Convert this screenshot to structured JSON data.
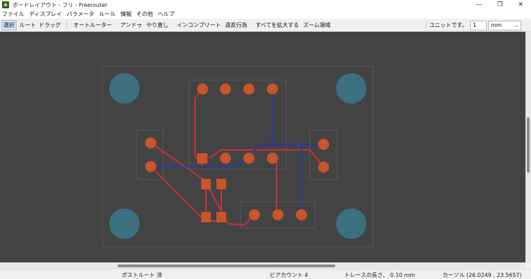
{
  "window": {
    "title": "ボードレイアウト - フリ - Freerouter",
    "controls": [
      "—",
      "❐",
      "✕"
    ]
  },
  "menu": [
    "ファイル",
    "ディスプレイ",
    "パラメータ",
    "ルール",
    "情報",
    "その他",
    "ヘルプ"
  ],
  "toolbar": {
    "select": "選択",
    "route": "ルート",
    "drag": "ドラッグ",
    "autorouter": "オートルーター",
    "undo": "アンドゥ",
    "redo": "やり直し",
    "incomplete": "インコンプリート",
    "violations": "違反行為",
    "zoom_all": "すべてを拡大する",
    "zoom_region": "ズーム領域",
    "unit_label": "ユニットです。",
    "unit_value": "1",
    "unit_select": "mm"
  },
  "status": {
    "postroute": "ポストルート 済",
    "via_count": "ビアカウント 4",
    "trace_length": "トレースの長さ、 0.10 mm",
    "cursor": "カーソル (26.0249 , 23.5657)"
  },
  "colors": {
    "canvas": "#434343",
    "pad": "#c8552c",
    "trace_front": "#c8323e",
    "trace_back": "#2b36b4",
    "mount_hole": "#3c7080",
    "outline": "#5a5a5a"
  }
}
